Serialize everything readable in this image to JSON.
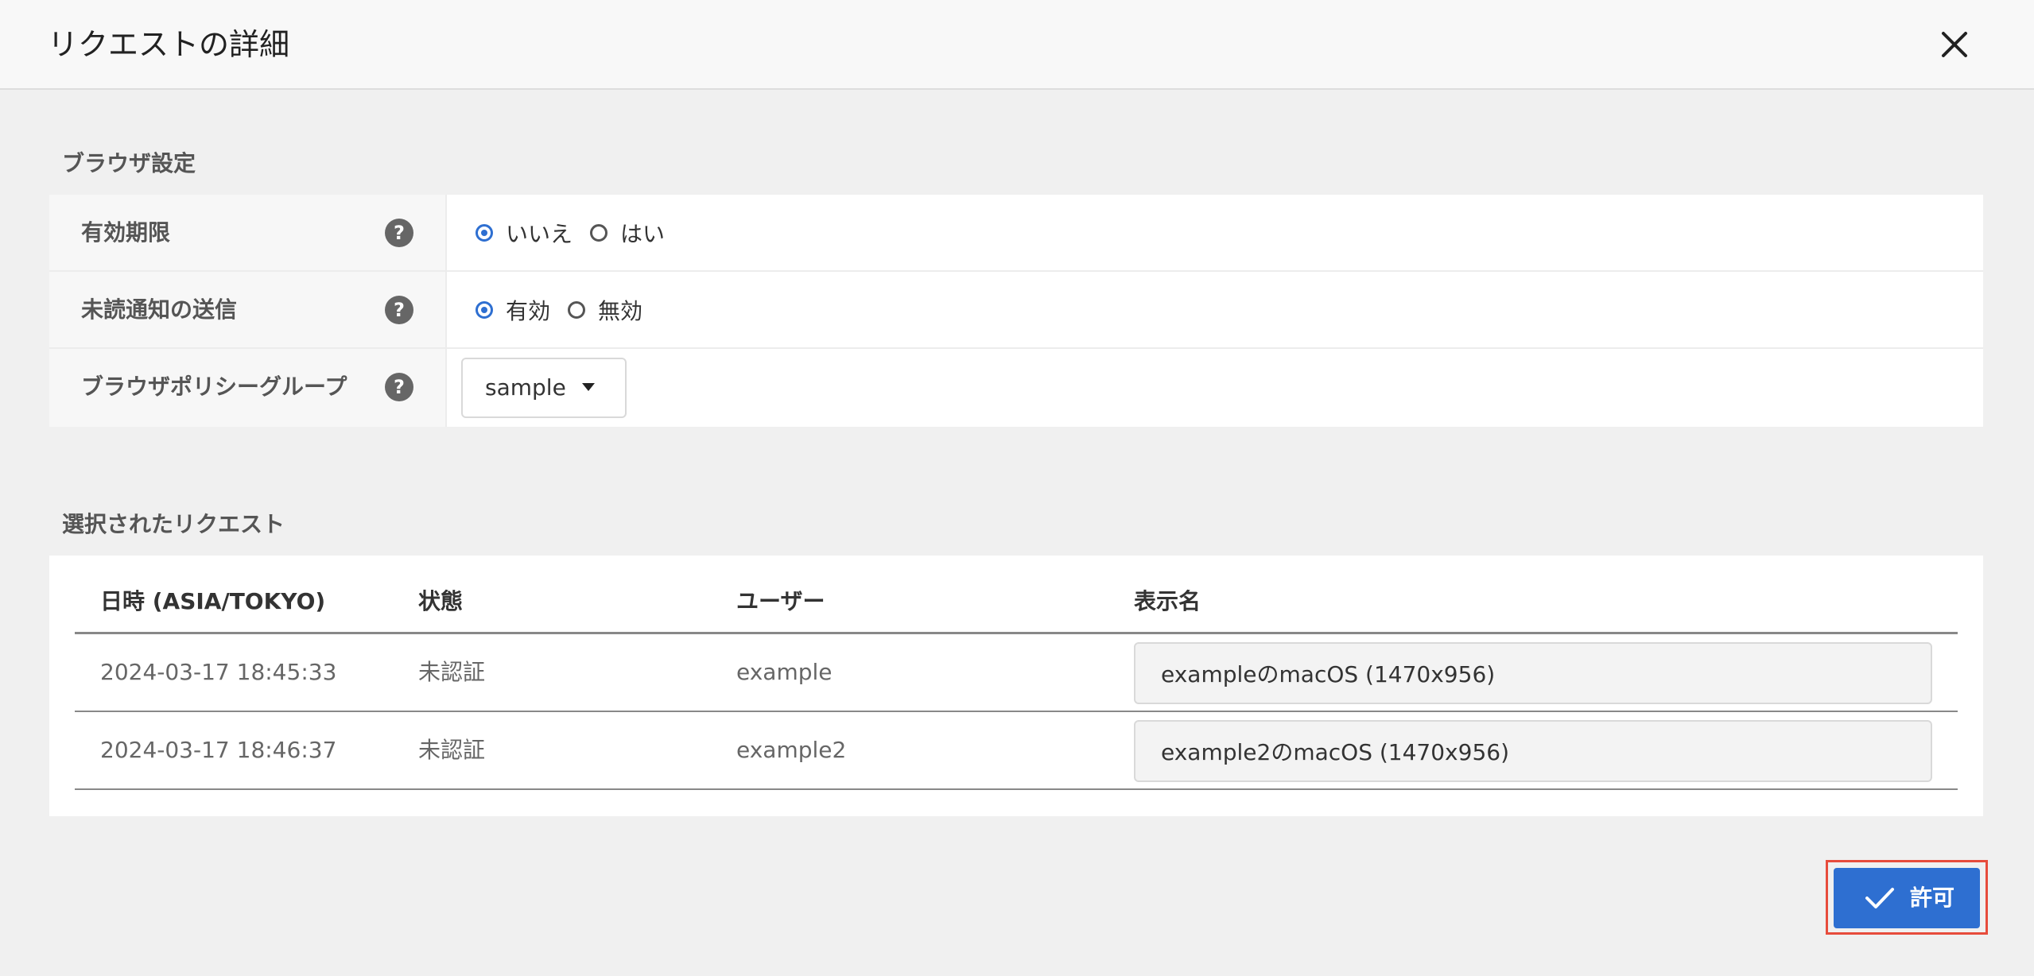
{
  "dialog": {
    "title": "リクエストの詳細"
  },
  "icons": {
    "close": "close-icon",
    "help": "help-icon",
    "dropdown": "caret-down-icon",
    "approve": "check-icon"
  },
  "browser_settings": {
    "section_title": "ブラウザ設定",
    "help_glyph": "?",
    "expiration": {
      "label": "有効期限",
      "options": [
        "いいえ",
        "はい"
      ],
      "selected": "いいえ"
    },
    "unread_notification": {
      "label": "未読通知の送信",
      "options": [
        "有効",
        "無効"
      ],
      "selected": "有効"
    },
    "policy_group": {
      "label": "ブラウザポリシーグループ",
      "selected": "sample"
    }
  },
  "selected_requests": {
    "section_title": "選択されたリクエスト",
    "columns": [
      "日時 (ASIA/TOKYO)",
      "状態",
      "ユーザー",
      "表示名"
    ],
    "rows": [
      {
        "datetime": "2024-03-17 18:45:33",
        "status": "未認証",
        "user": "example",
        "display_name": "exampleのmacOS (1470x956)"
      },
      {
        "datetime": "2024-03-17 18:46:37",
        "status": "未認証",
        "user": "example2",
        "display_name": "example2のmacOS (1470x956)"
      }
    ]
  },
  "actions": {
    "approve_label": "許可"
  },
  "colors": {
    "accent": "#2e6fd1",
    "highlight": "#e74c3c",
    "background": "#f0f0f0"
  }
}
